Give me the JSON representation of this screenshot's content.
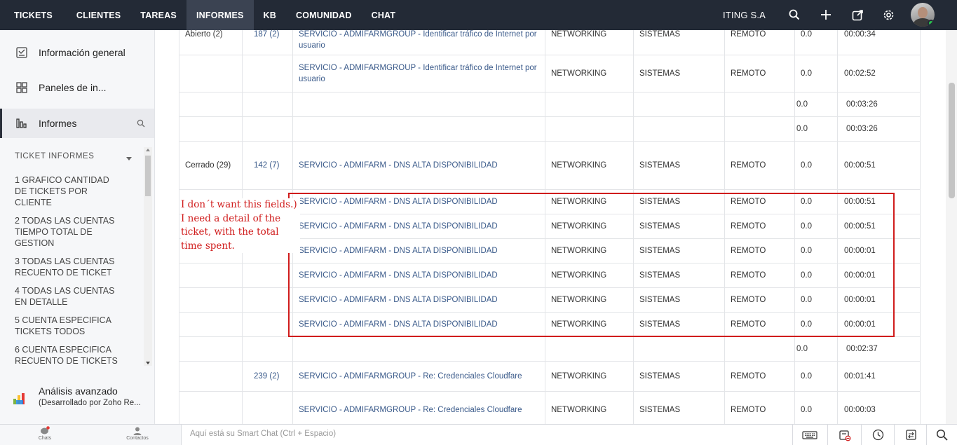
{
  "topbar": {
    "nav": [
      "TICKETS",
      "CLIENTES",
      "TAREAS",
      "INFORMES",
      "KB",
      "COMUNIDAD",
      "CHAT"
    ],
    "active": "INFORMES",
    "org_name": "ITING S.A"
  },
  "sidebar": {
    "items": [
      {
        "label": "Información general",
        "icon": "overview-icon"
      },
      {
        "label": "Paneles de in...",
        "icon": "dashboard-icon"
      },
      {
        "label": "Informes",
        "icon": "reports-icon"
      }
    ],
    "section_title": "TICKET INFORMES",
    "reports": [
      "1 GRAFICO CANTIDAD DE TICKETS POR CLIENTE",
      "2 TODAS LAS CUENTAS TIEMPO TOTAL DE GESTION",
      "3 TODAS LAS CUENTAS RECUENTO DE TICKET",
      "4 TODAS LAS CUENTAS EN DETALLE",
      "5 CUENTA ESPECIFICA TICKETS TODOS",
      "6 CUENTA ESPECIFICA RECUENTO DE TICKETS"
    ],
    "advanced_title": "Análisis avanzado",
    "advanced_subtitle": "(Desarrollado por Zoho Re..."
  },
  "table": {
    "rows": [
      {
        "status": "Abierto (2)",
        "id": "187 (2)",
        "subject": "SERVICIO - ADMIFARMGROUP - Identificar tráfico de Internet por usuario",
        "cat": "NETWORKING",
        "dept": "SISTEMAS",
        "mode": "REMOTO",
        "n": "0.0",
        "time": "00:00:34"
      },
      {
        "status": "",
        "id": "",
        "subject": "SERVICIO - ADMIFARMGROUP - Identificar tráfico de Internet por usuario",
        "cat": "NETWORKING",
        "dept": "SISTEMAS",
        "mode": "REMOTO",
        "n": "0.0",
        "time": "00:02:52"
      },
      {
        "status": "",
        "id": "",
        "subject": "",
        "cat": "",
        "dept": "",
        "mode": "",
        "n": "0.0",
        "time": "00:03:26"
      },
      {
        "status": "",
        "id": "",
        "subject": "",
        "cat": "",
        "dept": "",
        "mode": "",
        "n": "0.0",
        "time": "00:03:26"
      },
      {
        "status": "Cerrado (29)",
        "id": "142 (7)",
        "subject": "SERVICIO - ADMIFARM - DNS ALTA DISPONIBILIDAD",
        "cat": "NETWORKING",
        "dept": "SISTEMAS",
        "mode": "REMOTO",
        "n": "0.0",
        "time": "00:00:51"
      },
      {
        "status": "",
        "id": "",
        "subject": "SERVICIO - ADMIFARM - DNS ALTA DISPONIBILIDAD",
        "cat": "NETWORKING",
        "dept": "SISTEMAS",
        "mode": "REMOTO",
        "n": "0.0",
        "time": "00:00:51"
      },
      {
        "status": "",
        "id": "",
        "subject": "SERVICIO - ADMIFARM - DNS ALTA DISPONIBILIDAD",
        "cat": "NETWORKING",
        "dept": "SISTEMAS",
        "mode": "REMOTO",
        "n": "0.0",
        "time": "00:00:51"
      },
      {
        "status": "",
        "id": "",
        "subject": "SERVICIO - ADMIFARM - DNS ALTA DISPONIBILIDAD",
        "cat": "NETWORKING",
        "dept": "SISTEMAS",
        "mode": "REMOTO",
        "n": "0.0",
        "time": "00:00:01"
      },
      {
        "status": "",
        "id": "",
        "subject": "SERVICIO - ADMIFARM - DNS ALTA DISPONIBILIDAD",
        "cat": "NETWORKING",
        "dept": "SISTEMAS",
        "mode": "REMOTO",
        "n": "0.0",
        "time": "00:00:01"
      },
      {
        "status": "",
        "id": "",
        "subject": "SERVICIO - ADMIFARM - DNS ALTA DISPONIBILIDAD",
        "cat": "NETWORKING",
        "dept": "SISTEMAS",
        "mode": "REMOTO",
        "n": "0.0",
        "time": "00:00:01"
      },
      {
        "status": "",
        "id": "",
        "subject": "SERVICIO - ADMIFARM - DNS ALTA DISPONIBILIDAD",
        "cat": "NETWORKING",
        "dept": "SISTEMAS",
        "mode": "REMOTO",
        "n": "0.0",
        "time": "00:00:01"
      },
      {
        "status": "",
        "id": "",
        "subject": "",
        "cat": "",
        "dept": "",
        "mode": "",
        "n": "0.0",
        "time": "00:02:37"
      },
      {
        "status": "",
        "id": "239 (2)",
        "subject": "SERVICIO - ADMIFARMGROUP - Re: Credenciales Cloudfare",
        "cat": "NETWORKING",
        "dept": "SISTEMAS",
        "mode": "REMOTO",
        "n": "0.0",
        "time": "00:01:41"
      },
      {
        "status": "",
        "id": "",
        "subject": "SERVICIO - ADMIFARMGROUP - Re: Credenciales Cloudfare",
        "cat": "NETWORKING",
        "dept": "SISTEMAS",
        "mode": "REMOTO",
        "n": "0.0",
        "time": "00:00:03"
      }
    ]
  },
  "annotation": {
    "lines": [
      "I don´t want this fields.)",
      "I need a detail of the",
      "ticket, with the total",
      "time spent."
    ],
    "color": "#d01c1c"
  },
  "bottombar": {
    "chats_label": "Chats",
    "contacts_label": "Contactos",
    "smartchat_placeholder": "Aquí está su Smart Chat (Ctrl + Espacio)"
  }
}
